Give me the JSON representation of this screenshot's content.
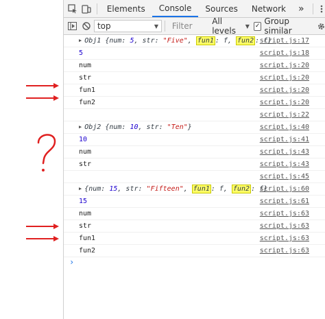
{
  "tabs": {
    "elements": "Elements",
    "console": "Console",
    "sources": "Sources",
    "network": "Network",
    "more": "»"
  },
  "toolbar": {
    "context": "top",
    "filter_placeholder": "Filter",
    "levels": "All levels",
    "group_similar": "Group similar"
  },
  "rows": [
    {
      "text_prefix": "Obj1 {num: ",
      "num": "5",
      "mid1": ", str: ",
      "str": "\"Five\"",
      "mid2": ", ",
      "fun1": "fun1",
      "f1": ": f, ",
      "fun2": "fun2",
      "f2": ": f}",
      "src": "script.js:17"
    },
    {
      "text": "5",
      "src": "script.js:18"
    },
    {
      "text": "num",
      "src": "script.js:20"
    },
    {
      "text": "str",
      "src": "script.js:20"
    },
    {
      "text": "fun1",
      "src": "script.js:20"
    },
    {
      "text": "fun2",
      "src": "script.js:20"
    },
    {
      "text": "",
      "src": "script.js:22"
    },
    {
      "text_prefix": "Obj2 {num: ",
      "num": "10",
      "mid1": ", str: ",
      "str": "\"Ten\"",
      "end": "}",
      "src": "script.js:40"
    },
    {
      "text": "10",
      "src": "script.js:41"
    },
    {
      "text": "num",
      "src": "script.js:43"
    },
    {
      "text": "str",
      "src": "script.js:43"
    },
    {
      "text": "",
      "src": "script.js:45"
    },
    {
      "text_prefix": "{num: ",
      "num": "15",
      "mid1": ", str: ",
      "str": "\"Fifteen\"",
      "mid2": ", ",
      "fun1": "fun1",
      "f1": ": f, ",
      "fun2": "fun2",
      "f2": ": f}",
      "src": "script.js:60"
    },
    {
      "text": "15",
      "src": "script.js:61"
    },
    {
      "text": "num",
      "src": "script.js:63"
    },
    {
      "text": "str",
      "src": "script.js:63"
    },
    {
      "text": "fun1",
      "src": "script.js:63"
    },
    {
      "text": "fun2",
      "src": "script.js:63"
    }
  ],
  "prompt": "›",
  "annotation_color": "#e02020"
}
